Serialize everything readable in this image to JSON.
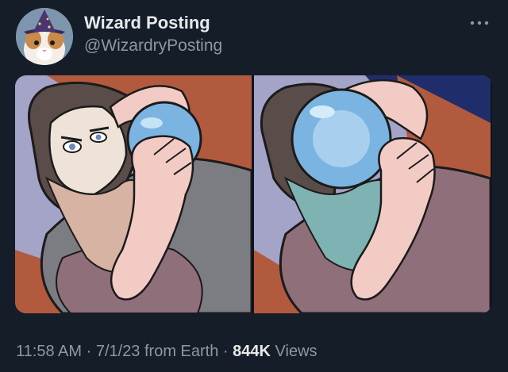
{
  "author": {
    "display_name": "Wizard Posting",
    "handle": "@WizardryPosting",
    "avatar_icon": "wizard-cat-avatar"
  },
  "more_icon": "more-horizontal-icon",
  "media": {
    "panels": [
      {
        "name": "wizard-peeking-at-crystal-ball"
      },
      {
        "name": "wizard-face-hidden-by-crystal-ball"
      }
    ]
  },
  "meta": {
    "time": "11:58 AM",
    "sep1": "·",
    "date": "7/1/23",
    "source": "from Earth",
    "sep2": "·",
    "views_count": "844K",
    "views_label": "Views"
  },
  "colors": {
    "background": "#151d28",
    "primary_text": "#e7e9ea",
    "secondary_text": "#8b98a5",
    "crystal_ball": "#7bb4e0"
  }
}
